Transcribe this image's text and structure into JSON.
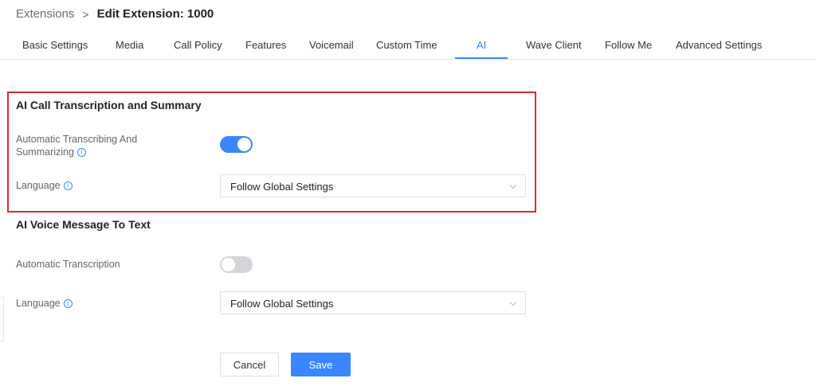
{
  "breadcrumb": {
    "parent": "Extensions",
    "separator": ">",
    "current": "Edit Extension: 1000"
  },
  "tabs": [
    {
      "label": "Basic Settings"
    },
    {
      "label": "Media"
    },
    {
      "label": "Call Policy"
    },
    {
      "label": "Features"
    },
    {
      "label": "Voicemail"
    },
    {
      "label": "Custom Time"
    },
    {
      "label": "AI",
      "active": true
    },
    {
      "label": "Wave Client"
    },
    {
      "label": "Follow Me"
    },
    {
      "label": "Advanced Settings"
    }
  ],
  "ai_call": {
    "title": "AI Call Transcription and Summary",
    "auto_label_line1": "Automatic Transcribing And",
    "auto_label_line2": "Summarizing",
    "auto_enabled": true,
    "language_label": "Language",
    "language_value": "Follow Global Settings"
  },
  "ai_voice": {
    "title": "AI Voice Message To Text",
    "auto_label": "Automatic Transcription",
    "auto_enabled": false,
    "language_label": "Language",
    "language_value": "Follow Global Settings"
  },
  "actions": {
    "cancel_label": "Cancel",
    "save_label": "Save"
  },
  "icons": {
    "info": "info-circle-icon",
    "dropdown": "chevron-down-icon"
  },
  "colors": {
    "accent": "#3a86ff",
    "highlight_border": "#d32f2f",
    "toggle_off": "#d3d5d9"
  }
}
